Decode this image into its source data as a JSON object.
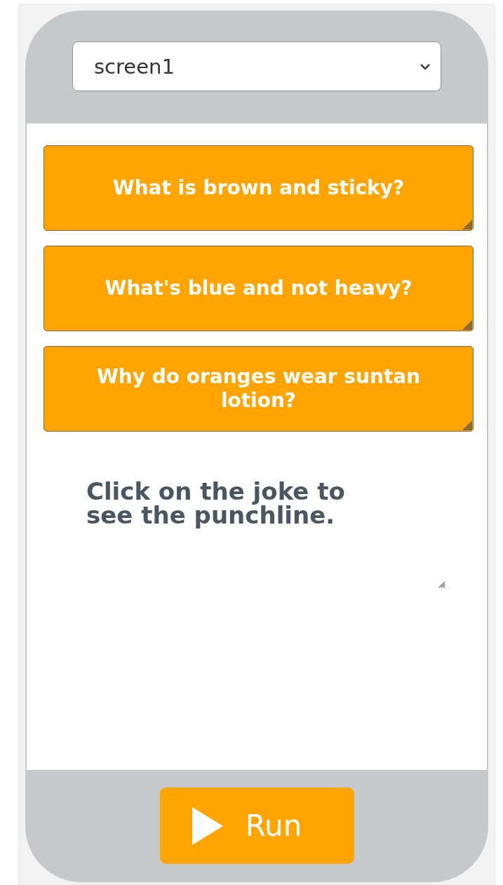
{
  "screen_selector": {
    "value": "screen1"
  },
  "buttons": [
    {
      "label": "What is brown and sticky?"
    },
    {
      "label": "What's blue and not heavy?"
    },
    {
      "label": "Why do oranges wear suntan lotion?"
    }
  ],
  "text_area": {
    "value": "Click on the joke to see the punchline."
  },
  "run_button": {
    "label": "Run"
  }
}
